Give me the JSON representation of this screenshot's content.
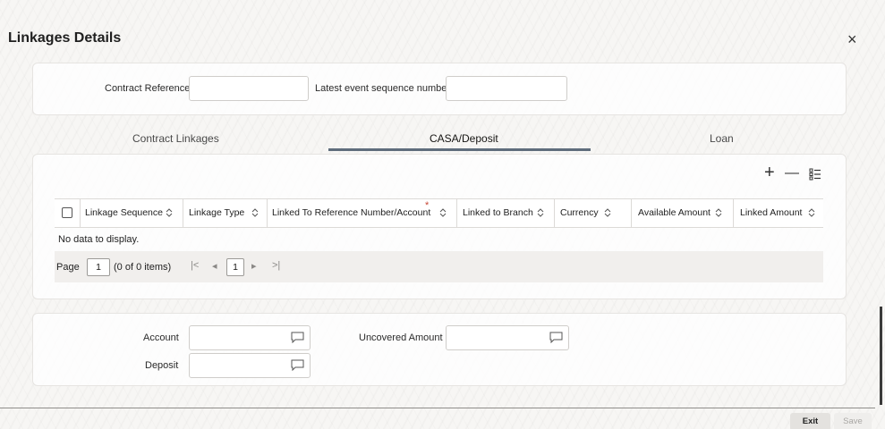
{
  "dialog": {
    "title": "Linkages Details",
    "close_glyph": "×"
  },
  "header_fields": {
    "contract_reference": {
      "label": "Contract Reference",
      "value": ""
    },
    "latest_event_seq": {
      "label": "Latest event sequence number",
      "value": ""
    }
  },
  "tabs": [
    {
      "label": "Contract Linkages",
      "active": false
    },
    {
      "label": "CASA/Deposit",
      "active": true
    },
    {
      "label": "Loan",
      "active": false
    }
  ],
  "toolbar": {
    "add_glyph": "+",
    "remove_glyph": "—",
    "columns_icon": "list-columns-icon"
  },
  "grid": {
    "columns": [
      "Linkage Sequence",
      "Linkage Type",
      "Linked To Reference Number/Account",
      "Linked to Branch",
      "Currency",
      "Available Amount",
      "Linked Amount"
    ],
    "required_marker": "*",
    "empty_text": "No data to display.",
    "pager": {
      "page_label": "Page",
      "page_value": "1",
      "items_text": "(0 of 0 items)",
      "first": "|<",
      "prev": "◂",
      "current": "1",
      "next": "▸",
      "last": ">|"
    }
  },
  "bottom_fields": {
    "account": {
      "label": "Account",
      "value": ""
    },
    "uncovered_amount": {
      "label": "Uncovered Amount",
      "value": ""
    },
    "deposit": {
      "label": "Deposit",
      "value": ""
    }
  },
  "buttons": {
    "exit": "Exit",
    "save": "Save"
  },
  "colors": {
    "tab_underline": "#5f6d7c",
    "required": "#c74634"
  }
}
